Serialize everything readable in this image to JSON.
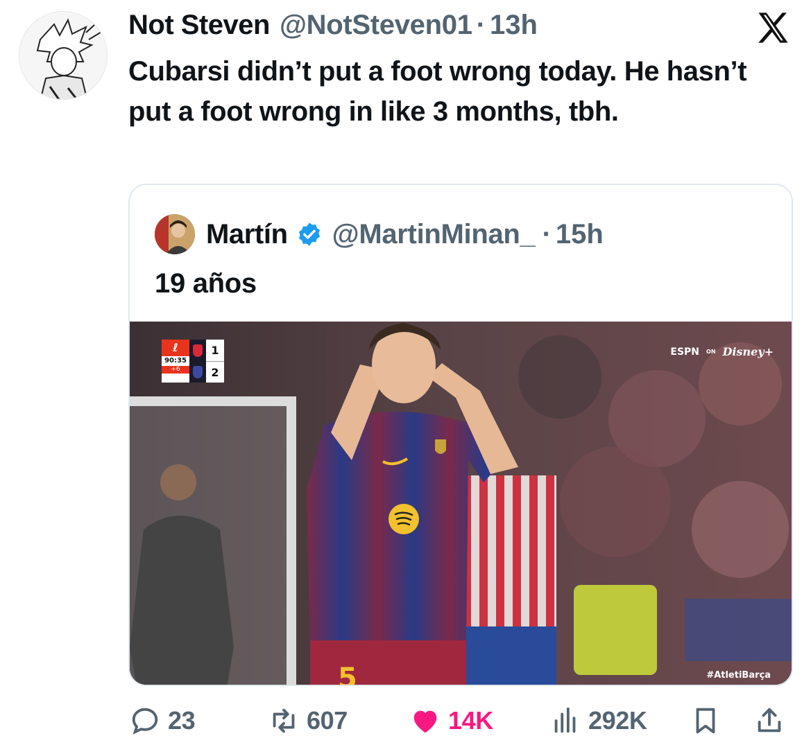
{
  "tweet": {
    "author_name": "Not Steven",
    "author_handle": "@NotSteven01",
    "separator": "·",
    "time": "13h",
    "text": "Cubarsi didn’t put a foot wrong today. He hasn’t put a foot wrong in like 3 months, tbh."
  },
  "quoted_tweet": {
    "author_name": "Martín",
    "author_handle": "@MartinMinan_",
    "separator": "·",
    "time": "15h",
    "text": "19 años",
    "media": {
      "scoreboard": {
        "clock": "90:35",
        "added_time": "+6",
        "home_goals": "1",
        "away_goals": "2"
      },
      "broadcaster_left": "ESPN",
      "broadcaster_on": "ON",
      "broadcaster_right": "Disney+",
      "hashtag": "#AtletiBarça",
      "shirt_number": "5"
    }
  },
  "actions": {
    "replies": "23",
    "reposts": "607",
    "likes": "14K",
    "views": "292K"
  },
  "colors": {
    "text_primary": "#0f1419",
    "text_secondary": "#536471",
    "like_pink": "#f91880",
    "verified_blue": "#1d9bf0",
    "border": "#e1e8ed"
  },
  "icons": [
    "x-logo-icon",
    "verified-badge-icon",
    "reply-icon",
    "repost-icon",
    "heart-icon",
    "views-icon",
    "bookmark-icon",
    "share-icon"
  ]
}
